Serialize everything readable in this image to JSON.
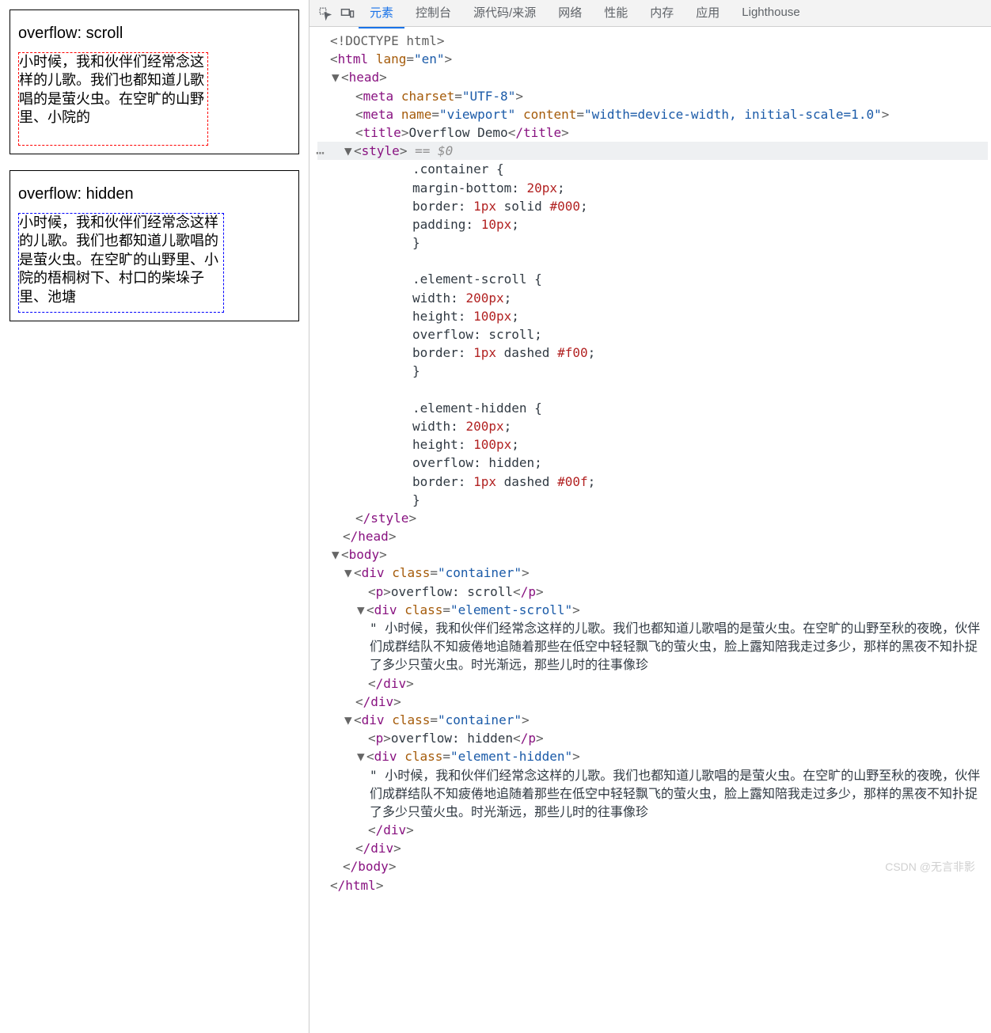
{
  "preview": {
    "scroll_label": "overflow: scroll",
    "hidden_label": "overflow: hidden",
    "scroll_text": "小时候，我和伙伴们经常念这样的儿歌。我们也都知道儿歌唱的是萤火虫。在空旷的山野里、小院的",
    "hidden_text": "小时候，我和伙伴们经常念这样的儿歌。我们也都知道儿歌唱的是萤火虫。在空旷的山野里、小院的梧桐树下、村口的柴垛子里、池塘"
  },
  "tabs": {
    "elements": "元素",
    "console": "控制台",
    "sources": "源代码/来源",
    "network": "网络",
    "performance": "性能",
    "memory": "内存",
    "application": "应用",
    "lighthouse": "Lighthouse"
  },
  "dom": {
    "doctype": "<!DOCTYPE html>",
    "html_open": "html",
    "html_lang_attr": "lang",
    "html_lang_val": "\"en\"",
    "head": "head",
    "meta1_attr": "charset",
    "meta1_val": "\"UTF-8\"",
    "meta2_name_attr": "name",
    "meta2_name_val": "\"viewport\"",
    "meta2_content_attr": "content",
    "meta2_content_val": "\"width=device-width, initial-scale=1.0\"",
    "title_tag": "title",
    "title_text": "Overflow Demo",
    "style_tag": "style",
    "eq0": " == $0",
    "style_close": "/style",
    "head_close": "/head",
    "body": "body",
    "div": "div",
    "class_attr": "class",
    "container_val": "\"container\"",
    "scroll_val": "\"element-scroll\"",
    "hidden_val": "\"element-hidden\"",
    "p_tag": "p",
    "p_scroll_text": "overflow: scroll",
    "p_hidden_text": "overflow: hidden",
    "text_quote": "\" 小时候，我和伙伴们经常念这样的儿歌。我们也都知道儿歌唱的是萤火虫。在空旷的山野至秋的夜晚，伙伴们成群结队不知疲倦地追随着那些在低空中轻轻飘飞的萤火虫，脸上露知陪我走过多少，那样的黑夜不知扑捉了多少只萤火虫。时光渐远，那些儿时的往事像珍",
    "div_close": "/div",
    "body_close": "/body",
    "html_close": "/html"
  },
  "css": {
    "container_sel": ".container {",
    "container_margin": "margin-bottom:",
    "container_margin_v": "20px",
    "container_border": "border:",
    "container_border_v1": "1px",
    "container_border_v2": "solid",
    "container_border_v3": "#000",
    "container_padding": "padding:",
    "container_padding_v": "10px",
    "close_brace": "}",
    "scroll_sel": ".element-scroll {",
    "width": "width:",
    "width_v": "200px",
    "height": "height:",
    "height_v": "100px",
    "overflow": "overflow:",
    "overflow_scroll_v": "scroll",
    "overflow_hidden_v": "hidden",
    "border": "border:",
    "border_dashed": "dashed",
    "border_red": "#f00",
    "border_blue": "#00f",
    "hidden_sel": ".element-hidden {"
  },
  "watermark": "CSDN @无言非影"
}
